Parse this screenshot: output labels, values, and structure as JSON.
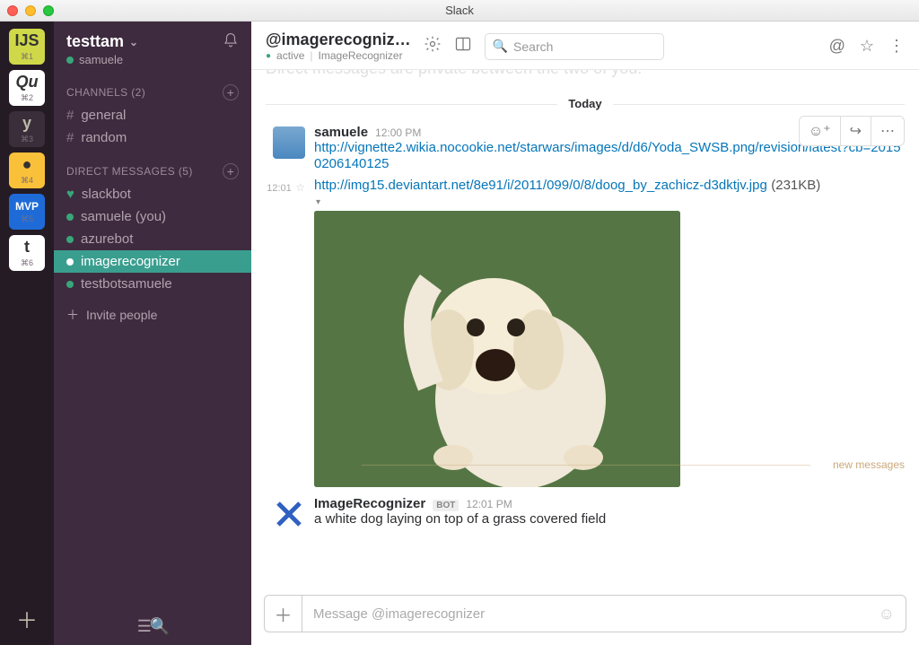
{
  "titlebar": {
    "app": "Slack"
  },
  "rail": {
    "items": [
      {
        "icon": "IJS",
        "key": "⌘1"
      },
      {
        "icon": "Qu",
        "key": "⌘2"
      },
      {
        "icon": "y",
        "key": "⌘3"
      },
      {
        "icon": "●",
        "key": "⌘4"
      },
      {
        "icon": "MVP",
        "key": "⌘5"
      },
      {
        "icon": "t",
        "key": "⌘6"
      }
    ]
  },
  "sidebar": {
    "team": "testtam",
    "user": "samuele",
    "channels_header": "CHANNELS (2)",
    "channels": [
      {
        "name": "general"
      },
      {
        "name": "random"
      }
    ],
    "dm_header": "DIRECT MESSAGES (5)",
    "dms": [
      {
        "name": "slackbot",
        "online": true
      },
      {
        "name": "samuele (you)",
        "online": true
      },
      {
        "name": "azurebot",
        "online": true
      },
      {
        "name": "imagerecognizer",
        "online": true,
        "selected": true
      },
      {
        "name": "testbotsamuele",
        "online": true
      }
    ],
    "invite": "Invite people"
  },
  "header": {
    "title": "@imagerecogniz…",
    "status": "active",
    "subtitle": "ImageRecognizer",
    "search_placeholder": "Search"
  },
  "chat": {
    "top_line": "Direct messages are private between the two of you.",
    "divider": "Today",
    "msg1": {
      "author": "samuele",
      "time": "12:00 PM",
      "link": "http://vignette2.wikia.nocookie.net/starwars/images/d/d6/Yoda_SWSB.png/revision/latest?cb=20150206140125"
    },
    "msg2": {
      "gutter_time": "12:01",
      "link": "http://img15.deviantart.net/8e91/i/2011/099/0/8/doog_by_zachicz-d3dktjv.jpg",
      "size": "(231KB)"
    },
    "msg3": {
      "author": "ImageRecognizer",
      "bot": "BOT",
      "time": "12:01 PM",
      "text": "a white dog laying on top of a grass covered field"
    },
    "newmsg": "new messages"
  },
  "composer": {
    "placeholder": "Message @imagerecognizer"
  }
}
